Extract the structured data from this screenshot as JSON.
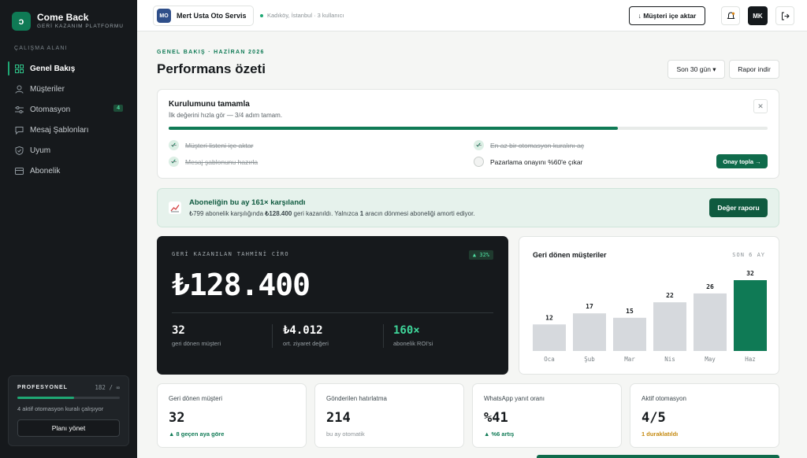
{
  "brand": {
    "name": "Come Back",
    "subtitle": "GERİ KAZANIM PLATFORMU",
    "logo_glyph": "ↄ"
  },
  "sidebar": {
    "section_label": "ÇALIŞMA ALANI",
    "items": [
      {
        "label": "Genel Bakış",
        "icon": "grid-icon",
        "active": true
      },
      {
        "label": "Müşteriler",
        "icon": "user-icon"
      },
      {
        "label": "Otomasyon",
        "icon": "sliders-icon",
        "badge": "4"
      },
      {
        "label": "Mesaj Şablonları",
        "icon": "message-icon"
      },
      {
        "label": "Uyum",
        "icon": "shield-icon"
      },
      {
        "label": "Abonelik",
        "icon": "card-icon"
      }
    ],
    "plan": {
      "title": "PROFESYONEL",
      "count": "182 / ∞",
      "usage_fraction": 0.55,
      "text": "4 aktif otomasyon kuralı çalışıyor",
      "button": "Planı yönet"
    }
  },
  "topbar": {
    "business_initials": "MO",
    "business_name": "Mert Usta Oto Servis",
    "location": "Kadıköy, İstanbul · 3 kullanıcı",
    "import_button": "↓ Müşteri içe aktar",
    "user_initials": "MK"
  },
  "header": {
    "overline": "GENEL BAKIŞ · HAZİRAN 2026",
    "title": "Performans özeti",
    "range_button": "Son 30 gün ▾",
    "report_button": "Rapor indir"
  },
  "setup": {
    "title": "Kurulumunu tamamla",
    "subtitle": "İlk değerini hızla gör — 3/4 adım tamam.",
    "progress_fraction": 0.75,
    "steps": [
      {
        "label": "Müşteri listeni içe aktar",
        "done": true
      },
      {
        "label": "En az bir otomasyon kuralını aç",
        "done": true
      },
      {
        "label": "Mesaj şablonunu hazırla",
        "done": true
      },
      {
        "label": "Pazarlama onayını %60'e çıkar",
        "done": false
      }
    ],
    "consent_button": "Onay topla →",
    "close_glyph": "✕"
  },
  "roi": {
    "title": "Aboneliğin bu ay 161× karşılandı",
    "text_pre": "₺799 abonelik karşılığında ",
    "text_amount": "₺128.400",
    "text_mid": " geri kazanıldı. Yalnızca ",
    "text_count": "1",
    "text_post": " aracın dönmesi aboneliği amorti ediyor.",
    "button": "Değer raporu"
  },
  "revenue": {
    "label": "GERİ KAZANILAN TAHMİNİ CİRO",
    "badge": "▲ 32%",
    "value": "₺128.400",
    "stats": [
      {
        "value": "32",
        "label": "geri dönen müşteri"
      },
      {
        "value": "₺4.012",
        "label": "ort. ziyaret değeri"
      },
      {
        "value": "160×",
        "label": "abonelik ROI'si"
      }
    ]
  },
  "chart_data": {
    "type": "bar",
    "title": "Geri dönen müşteriler",
    "subtitle": "SON 6 AY",
    "categories": [
      "Oca",
      "Şub",
      "Mar",
      "Nis",
      "May",
      "Haz"
    ],
    "values": [
      12,
      17,
      15,
      22,
      26,
      32
    ],
    "ylim": [
      0,
      32
    ],
    "highlight_index": 5,
    "colors": {
      "bar": "#d6d9dd",
      "highlight": "#0f7a55"
    },
    "grid": false
  },
  "kpis": [
    {
      "label": "Geri dönen müşteri",
      "value": "32",
      "note": "▲ 8 geçen aya göre",
      "tone": "up"
    },
    {
      "label": "Gönderilen hatırlatma",
      "value": "214",
      "note": "bu ay otomatik",
      "tone": "muted"
    },
    {
      "label": "WhatsApp yanıt oranı",
      "value": "%41",
      "note": "▲ %6 artış",
      "tone": "up"
    },
    {
      "label": "Aktif otomasyon",
      "value": "4/5",
      "note": "1 duraklatıldı",
      "tone": "warn"
    }
  ]
}
